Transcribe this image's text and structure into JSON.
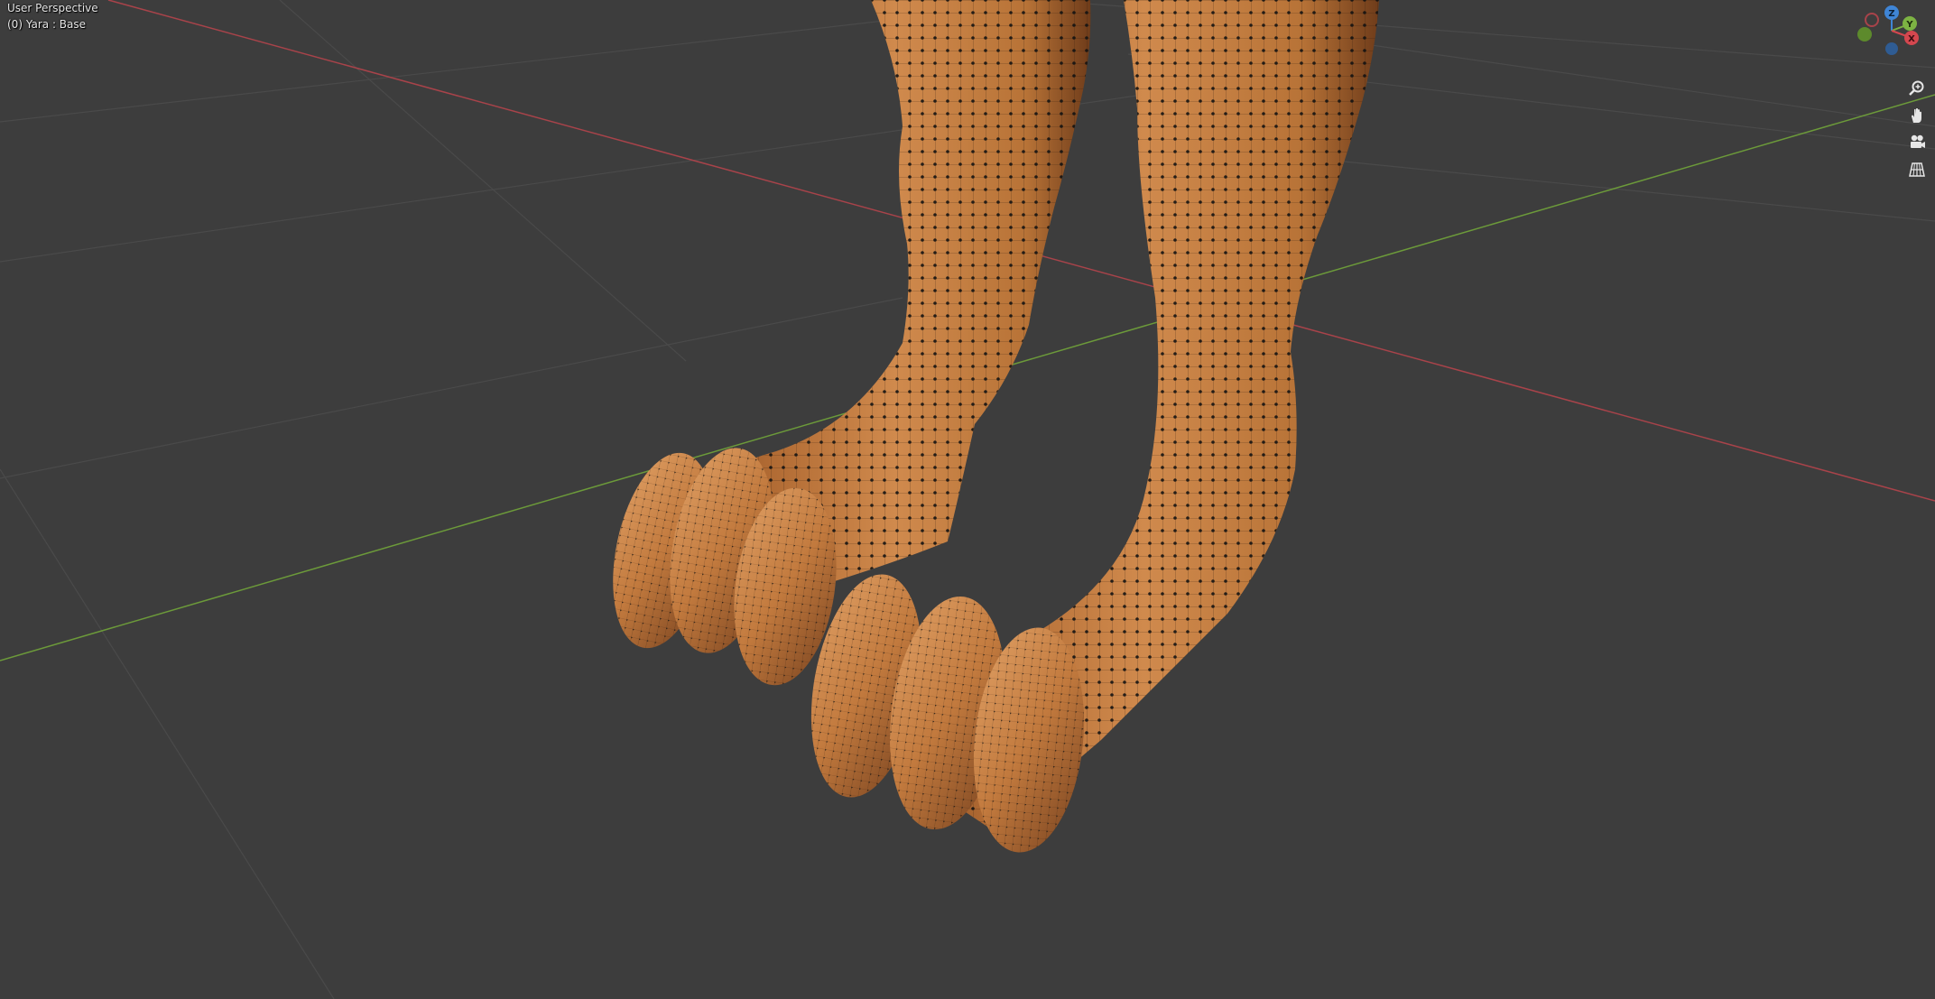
{
  "viewport": {
    "view_name": "User Perspective",
    "object_info": "(0) Yara  : Base",
    "background_color": "#3d3d3d",
    "axis_colors": {
      "x": "#d4474f",
      "y": "#7db343",
      "z": "#3f85d6"
    },
    "mesh_color": "#c47a40",
    "vertex_color": "#111111"
  },
  "gizmo": {
    "z_label": "Z",
    "y_label": "Y",
    "x_label": "X"
  },
  "navigation": {
    "zoom_icon": "zoom-magnifier-icon",
    "pan_icon": "hand-pan-icon",
    "camera_icon": "camera-icon",
    "grid_icon": "orthographic-grid-icon"
  }
}
